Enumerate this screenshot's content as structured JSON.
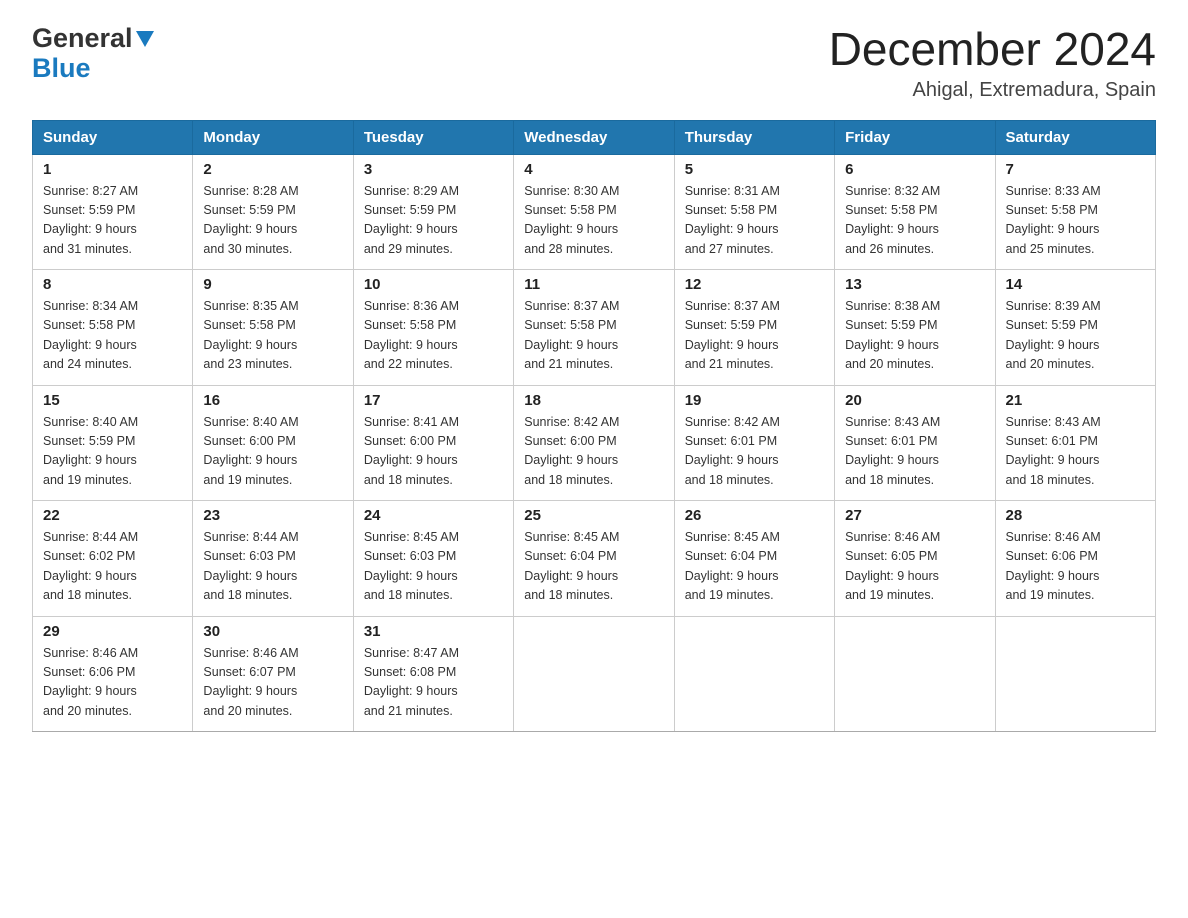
{
  "logo": {
    "general": "General",
    "blue": "Blue"
  },
  "header": {
    "month_year": "December 2024",
    "location": "Ahigal, Extremadura, Spain"
  },
  "weekdays": [
    "Sunday",
    "Monday",
    "Tuesday",
    "Wednesday",
    "Thursday",
    "Friday",
    "Saturday"
  ],
  "weeks": [
    [
      {
        "day": "1",
        "sunrise": "8:27 AM",
        "sunset": "5:59 PM",
        "daylight": "9 hours and 31 minutes."
      },
      {
        "day": "2",
        "sunrise": "8:28 AM",
        "sunset": "5:59 PM",
        "daylight": "9 hours and 30 minutes."
      },
      {
        "day": "3",
        "sunrise": "8:29 AM",
        "sunset": "5:59 PM",
        "daylight": "9 hours and 29 minutes."
      },
      {
        "day": "4",
        "sunrise": "8:30 AM",
        "sunset": "5:58 PM",
        "daylight": "9 hours and 28 minutes."
      },
      {
        "day": "5",
        "sunrise": "8:31 AM",
        "sunset": "5:58 PM",
        "daylight": "9 hours and 27 minutes."
      },
      {
        "day": "6",
        "sunrise": "8:32 AM",
        "sunset": "5:58 PM",
        "daylight": "9 hours and 26 minutes."
      },
      {
        "day": "7",
        "sunrise": "8:33 AM",
        "sunset": "5:58 PM",
        "daylight": "9 hours and 25 minutes."
      }
    ],
    [
      {
        "day": "8",
        "sunrise": "8:34 AM",
        "sunset": "5:58 PM",
        "daylight": "9 hours and 24 minutes."
      },
      {
        "day": "9",
        "sunrise": "8:35 AM",
        "sunset": "5:58 PM",
        "daylight": "9 hours and 23 minutes."
      },
      {
        "day": "10",
        "sunrise": "8:36 AM",
        "sunset": "5:58 PM",
        "daylight": "9 hours and 22 minutes."
      },
      {
        "day": "11",
        "sunrise": "8:37 AM",
        "sunset": "5:58 PM",
        "daylight": "9 hours and 21 minutes."
      },
      {
        "day": "12",
        "sunrise": "8:37 AM",
        "sunset": "5:59 PM",
        "daylight": "9 hours and 21 minutes."
      },
      {
        "day": "13",
        "sunrise": "8:38 AM",
        "sunset": "5:59 PM",
        "daylight": "9 hours and 20 minutes."
      },
      {
        "day": "14",
        "sunrise": "8:39 AM",
        "sunset": "5:59 PM",
        "daylight": "9 hours and 20 minutes."
      }
    ],
    [
      {
        "day": "15",
        "sunrise": "8:40 AM",
        "sunset": "5:59 PM",
        "daylight": "9 hours and 19 minutes."
      },
      {
        "day": "16",
        "sunrise": "8:40 AM",
        "sunset": "6:00 PM",
        "daylight": "9 hours and 19 minutes."
      },
      {
        "day": "17",
        "sunrise": "8:41 AM",
        "sunset": "6:00 PM",
        "daylight": "9 hours and 18 minutes."
      },
      {
        "day": "18",
        "sunrise": "8:42 AM",
        "sunset": "6:00 PM",
        "daylight": "9 hours and 18 minutes."
      },
      {
        "day": "19",
        "sunrise": "8:42 AM",
        "sunset": "6:01 PM",
        "daylight": "9 hours and 18 minutes."
      },
      {
        "day": "20",
        "sunrise": "8:43 AM",
        "sunset": "6:01 PM",
        "daylight": "9 hours and 18 minutes."
      },
      {
        "day": "21",
        "sunrise": "8:43 AM",
        "sunset": "6:01 PM",
        "daylight": "9 hours and 18 minutes."
      }
    ],
    [
      {
        "day": "22",
        "sunrise": "8:44 AM",
        "sunset": "6:02 PM",
        "daylight": "9 hours and 18 minutes."
      },
      {
        "day": "23",
        "sunrise": "8:44 AM",
        "sunset": "6:03 PM",
        "daylight": "9 hours and 18 minutes."
      },
      {
        "day": "24",
        "sunrise": "8:45 AM",
        "sunset": "6:03 PM",
        "daylight": "9 hours and 18 minutes."
      },
      {
        "day": "25",
        "sunrise": "8:45 AM",
        "sunset": "6:04 PM",
        "daylight": "9 hours and 18 minutes."
      },
      {
        "day": "26",
        "sunrise": "8:45 AM",
        "sunset": "6:04 PM",
        "daylight": "9 hours and 19 minutes."
      },
      {
        "day": "27",
        "sunrise": "8:46 AM",
        "sunset": "6:05 PM",
        "daylight": "9 hours and 19 minutes."
      },
      {
        "day": "28",
        "sunrise": "8:46 AM",
        "sunset": "6:06 PM",
        "daylight": "9 hours and 19 minutes."
      }
    ],
    [
      {
        "day": "29",
        "sunrise": "8:46 AM",
        "sunset": "6:06 PM",
        "daylight": "9 hours and 20 minutes."
      },
      {
        "day": "30",
        "sunrise": "8:46 AM",
        "sunset": "6:07 PM",
        "daylight": "9 hours and 20 minutes."
      },
      {
        "day": "31",
        "sunrise": "8:47 AM",
        "sunset": "6:08 PM",
        "daylight": "9 hours and 21 minutes."
      },
      null,
      null,
      null,
      null
    ]
  ],
  "labels": {
    "sunrise": "Sunrise:",
    "sunset": "Sunset:",
    "daylight": "Daylight:"
  }
}
